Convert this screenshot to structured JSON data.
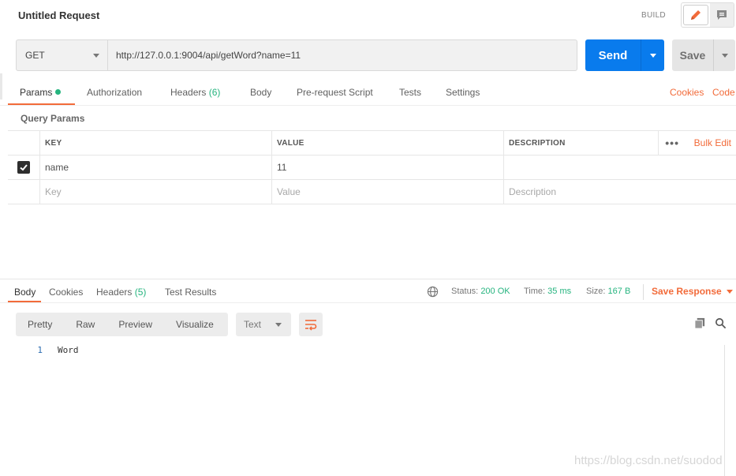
{
  "header": {
    "title": "Untitled Request",
    "build_label": "BUILD",
    "icons": {
      "edit": "pencil-icon",
      "comments": "comment-icon"
    },
    "accent": "#f26b3a"
  },
  "request": {
    "method": "GET",
    "url": "http://127.0.0.1:9004/api/getWord?name=11",
    "send_label": "Send",
    "save_label": "Save",
    "send_color": "#097bed"
  },
  "request_tabs": [
    {
      "label": "Params",
      "active": true
    },
    {
      "label": "Authorization"
    },
    {
      "label": "Headers",
      "count": "(6)"
    },
    {
      "label": "Body"
    },
    {
      "label": "Pre-request Script"
    },
    {
      "label": "Tests"
    },
    {
      "label": "Settings"
    }
  ],
  "right_links": {
    "cookies": "Cookies",
    "code": "Code"
  },
  "query_params": {
    "title": "Query Params",
    "headers": {
      "key": "KEY",
      "value": "VALUE",
      "description": "DESCRIPTION"
    },
    "more": "•••",
    "bulk_edit": "Bulk Edit",
    "rows": [
      {
        "checked": true,
        "key": "name",
        "value": "11",
        "description": ""
      }
    ],
    "placeholder": {
      "key": "Key",
      "value": "Value",
      "description": "Description"
    }
  },
  "response": {
    "tabs": [
      {
        "label": "Body",
        "active": true
      },
      {
        "label": "Cookies"
      },
      {
        "label": "Headers",
        "count": "(5)"
      },
      {
        "label": "Test Results"
      }
    ],
    "status_label": "Status:",
    "status_value": "200 OK",
    "time_label": "Time:",
    "time_value": "35 ms",
    "size_label": "Size:",
    "size_value": "167 B",
    "save_response": "Save Response",
    "views": [
      "Pretty",
      "Raw",
      "Preview",
      "Visualize"
    ],
    "format": "Text",
    "lines": [
      {
        "num": "1",
        "text": "Word"
      }
    ],
    "success_color": "#26b47f"
  },
  "watermark": "https://blog.csdn.net/suodod"
}
